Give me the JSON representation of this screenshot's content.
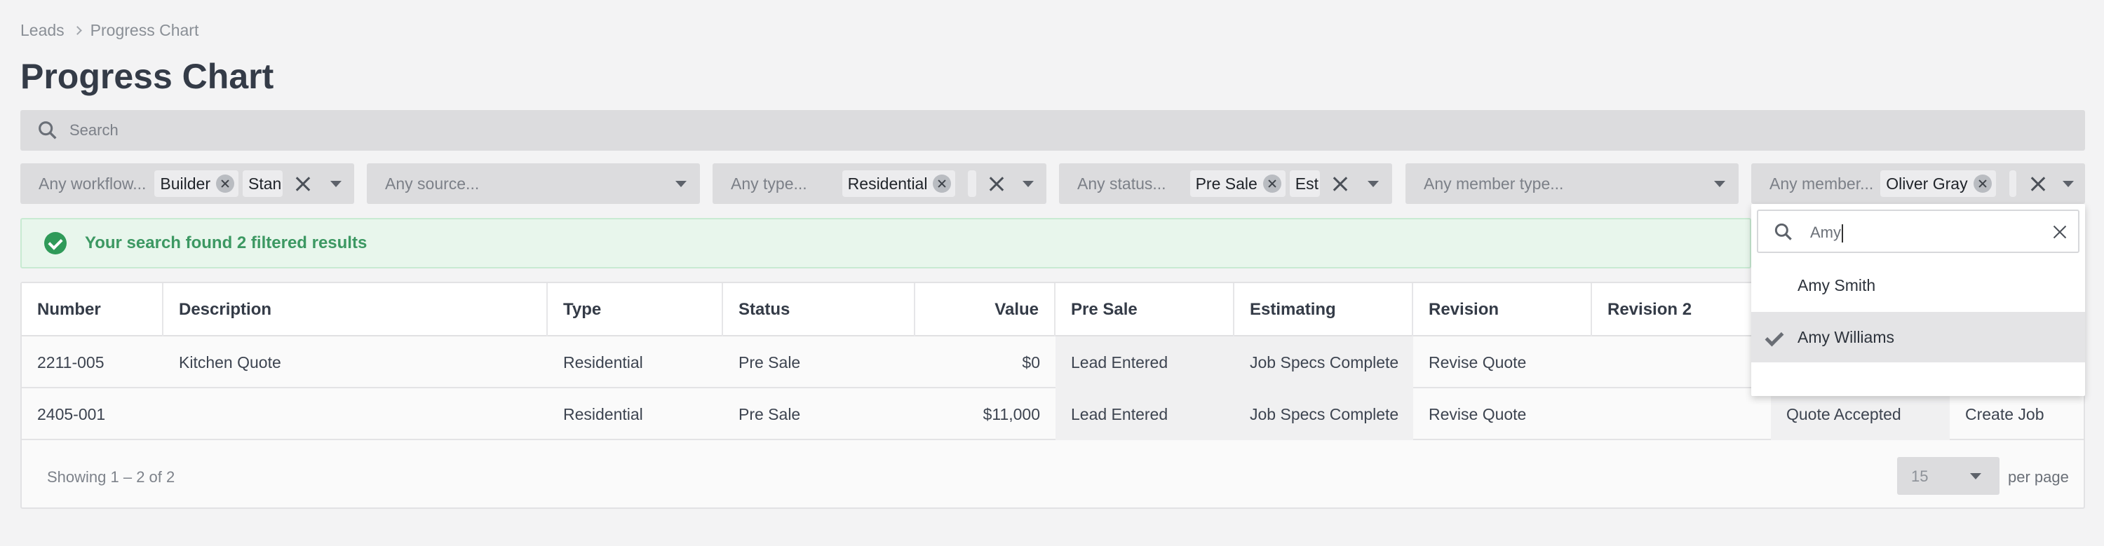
{
  "breadcrumb": {
    "root": "Leads",
    "current": "Progress Chart"
  },
  "page_title": "Progress Chart",
  "search": {
    "placeholder": "Search"
  },
  "filters": {
    "workflow": {
      "placeholder": "Any workflow...",
      "chips": [
        "Builder",
        "Stan"
      ]
    },
    "source": {
      "placeholder": "Any source..."
    },
    "type": {
      "placeholder": "Any type...",
      "chips": [
        "Residential"
      ]
    },
    "status": {
      "placeholder": "Any status...",
      "chips": [
        "Pre Sale",
        "Est"
      ]
    },
    "member_type": {
      "placeholder": "Any member type..."
    },
    "member": {
      "placeholder": "Any member...",
      "chips": [
        "Oliver Gray"
      ]
    }
  },
  "alert": {
    "message": "Your search found 2 filtered results"
  },
  "table": {
    "columns": [
      "Number",
      "Description",
      "Type",
      "Status",
      "Value",
      "Pre Sale",
      "Estimating",
      "Revision",
      "Revision 2"
    ],
    "rows": [
      {
        "number": "2211-005",
        "description": "Kitchen Quote",
        "type": "Residential",
        "status": "Pre Sale",
        "value": "$0",
        "pre_sale": "Lead Entered",
        "estimating": "Job Specs Complete",
        "revision": "Revise Quote",
        "revision2": "",
        "col10": "",
        "col11": ""
      },
      {
        "number": "2405-001",
        "description": "",
        "type": "Residential",
        "status": "Pre Sale",
        "value": "$11,000",
        "pre_sale": "Lead Entered",
        "estimating": "Job Specs Complete",
        "revision": "Revise Quote",
        "revision2": "",
        "col10": "Quote Accepted",
        "col11": "Create Job"
      }
    ]
  },
  "footer": {
    "showing": "Showing 1 – 2 of 2",
    "per_page_value": "15",
    "per_page_label": "per page"
  },
  "member_dropdown": {
    "search_value": "Amy",
    "options": [
      {
        "label": "Amy Smith",
        "selected": false
      },
      {
        "label": "Amy Williams",
        "selected": true
      }
    ]
  }
}
